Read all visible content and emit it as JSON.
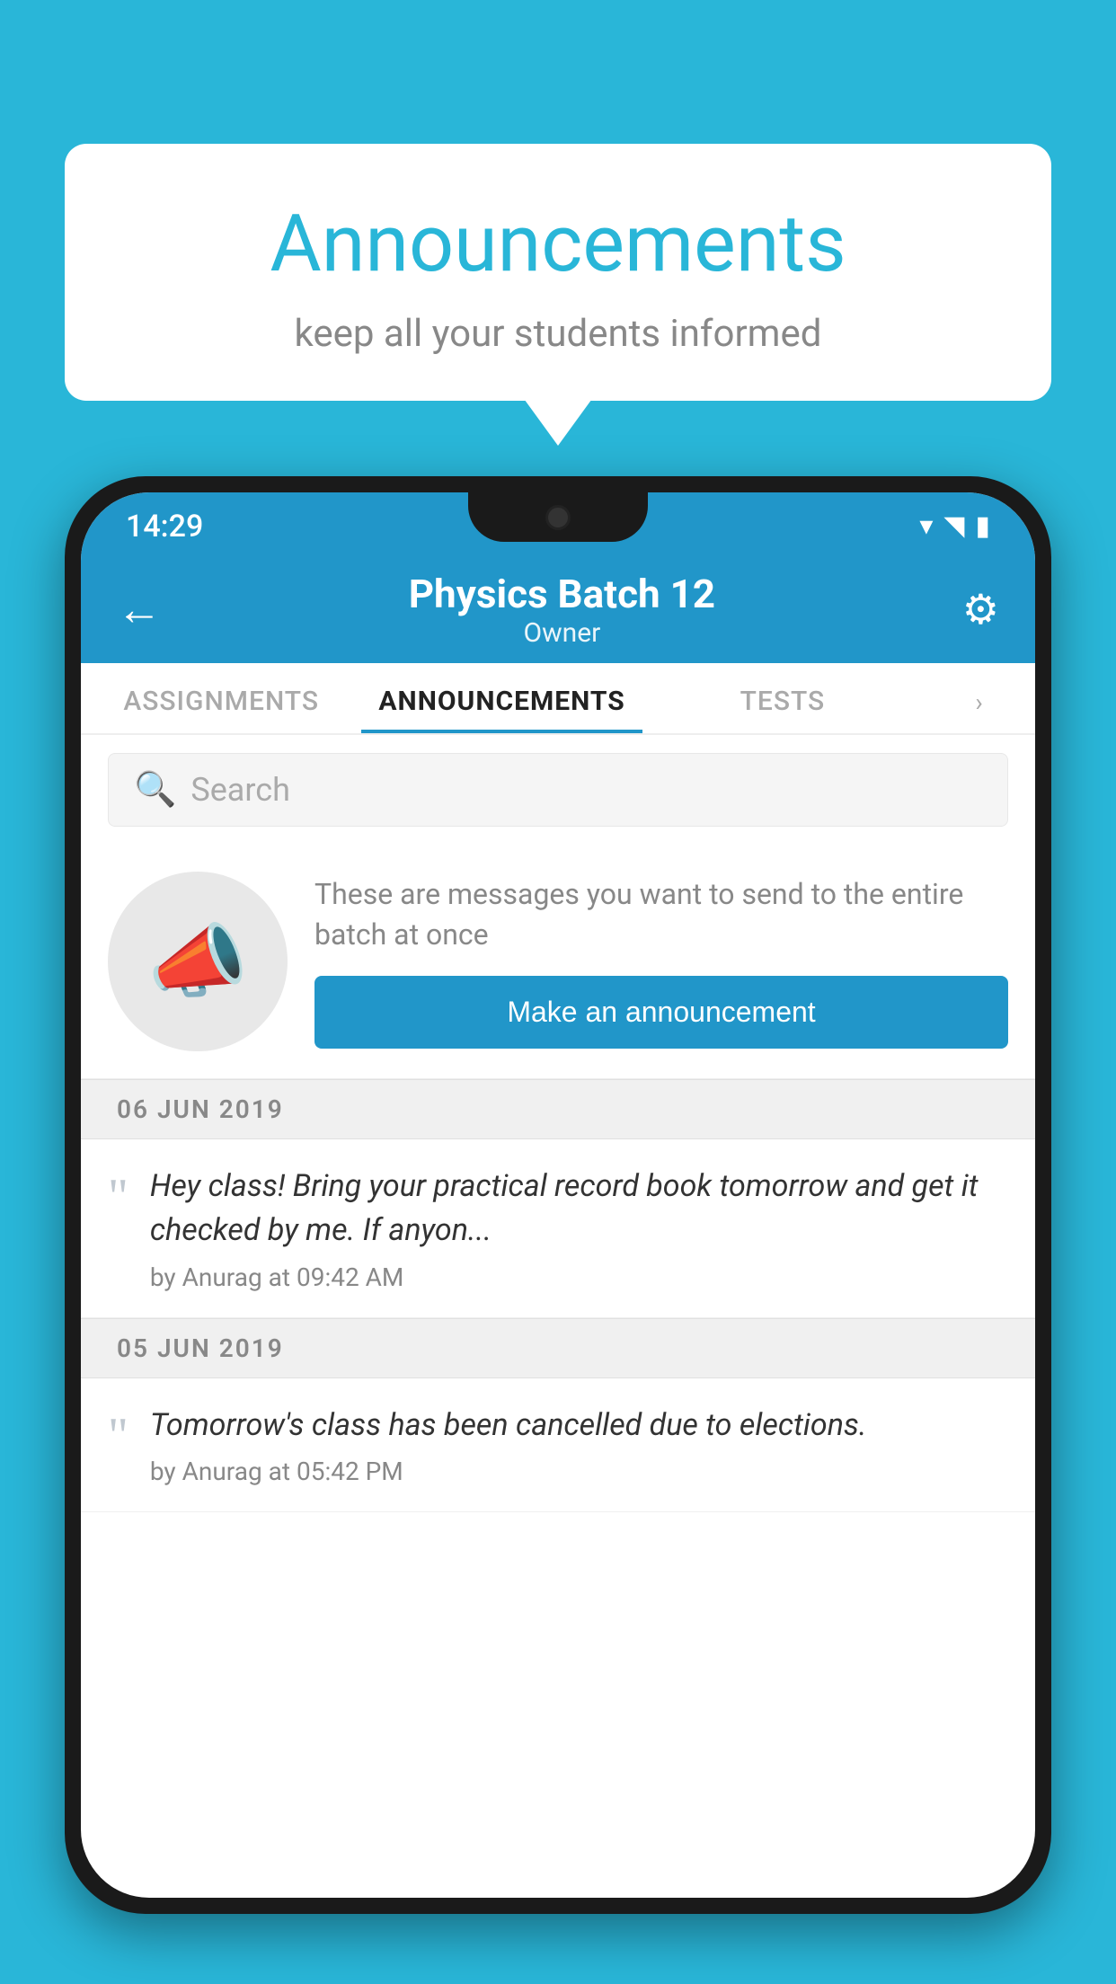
{
  "background_color": "#29B6D8",
  "speech_bubble": {
    "title": "Announcements",
    "subtitle": "keep all your students informed"
  },
  "status_bar": {
    "time": "14:29",
    "wifi_symbol": "▼",
    "signal_symbol": "▲",
    "battery_symbol": "▮"
  },
  "top_bar": {
    "back_label": "←",
    "title": "Physics Batch 12",
    "subtitle": "Owner",
    "gear_symbol": "⚙"
  },
  "tabs": [
    {
      "label": "ASSIGNMENTS",
      "active": false
    },
    {
      "label": "ANNOUNCEMENTS",
      "active": true
    },
    {
      "label": "TESTS",
      "active": false
    }
  ],
  "search": {
    "placeholder": "Search",
    "search_icon": "🔍"
  },
  "promo": {
    "description": "These are messages you want to send to the entire batch at once",
    "button_label": "Make an announcement"
  },
  "announcements": [
    {
      "date": "06  JUN  2019",
      "message": "Hey class! Bring your practical record book tomorrow and get it checked by me. If anyon...",
      "meta": "by Anurag at 09:42 AM"
    },
    {
      "date": "05  JUN  2019",
      "message": "Tomorrow's class has been cancelled due to elections.",
      "meta": "by Anurag at 05:42 PM"
    }
  ]
}
